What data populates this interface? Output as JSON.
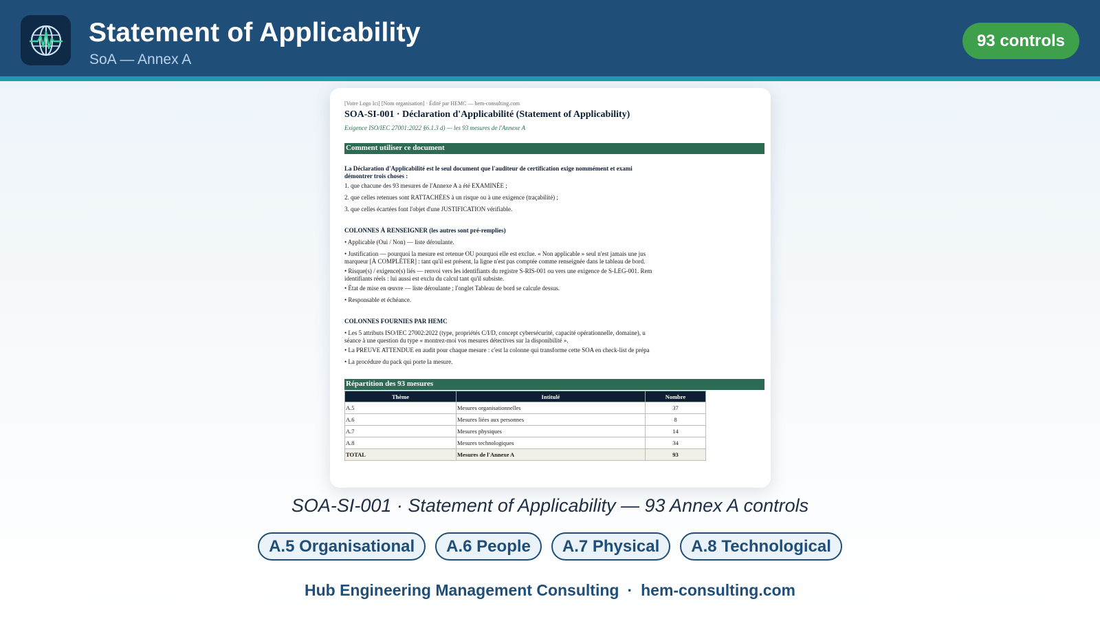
{
  "colors": {
    "header_bg": "#1f4e79",
    "header_accent": "#1f9bb0",
    "badge_green": "#3ea04a",
    "section_green": "#2e6b55",
    "table_header": "#0e1f33"
  },
  "header": {
    "logo_icon": "globe-heartbeat-icon",
    "title": "Statement of Applicability",
    "subtitle": "SoA — Annex A",
    "badge": "93 controls"
  },
  "document": {
    "meta": "[Votre Logo Ici]  [Nom organisation]  · Édité par HEMC — hem-consulting.com",
    "title": "SOA-SI-001 · Déclaration d'Applicabilité (Statement of Applicability)",
    "requirement": "Exigence ISO/IEC 27001:2022 §6.1.3 d) — les 93 mesures de l'Annexe A",
    "section1": "Comment utiliser ce document",
    "intro_line1": "La Déclaration d'Applicabilité est le seul document que l'auditeur de certification exige nommément et exami",
    "intro_line2": "démontrer trois choses :",
    "point1": "1. que chacune des 93 mesures de l'Annexe A a été EXAMINÉE ;",
    "point2": "2. que celles retenues sont RATTACHÉES à un risque ou à une exigence (traçabilité) ;",
    "point3": "3. que celles écartées font l'objet d'une JUSTIFICATION vérifiable.",
    "cols_title": "COLONNES À RENSEIGNER (les autres sont pré-remplies)",
    "col1": "• Applicable (Oui / Non) — liste déroulante.",
    "col2a": "• Justification — pourquoi la mesure est retenue OU pourquoi elle est exclue. « Non applicable » seul n'est jamais une jus",
    "col2b": "marqueur [À COMPLÉTER] : tant qu'il est présent, la ligne n'est pas comptée comme renseignée dans le tableau de bord.",
    "col3a": "• Risque(s) / exigence(s) liés — renvoi vers les identifiants du registre S-RIS-001 ou vers une exigence de S-LEG-001. Rem",
    "col3b": "identifiants réels : lui aussi est exclu du calcul tant qu'il subsiste.",
    "col4": "• État de mise en œuvre — liste déroulante ; l'onglet Tableau de bord se calcule dessus.",
    "col5": "• Responsable et échéance.",
    "hemc_title": "COLONNES FOURNIES PAR HEMC",
    "hemc1a": "• Les 5 attributs ISO/IEC 27002:2022 (type, propriétés C/I/D, concept cybersécurité, capacité opérationnelle, domaine), u",
    "hemc1b": "séance à une question du type « montrez-moi vos mesures détectives sur la disponibilité ».",
    "hemc2": "• La PREUVE ATTENDUE en audit pour chaque mesure : c'est la colonne qui transforme cette SOA en check-list de prépa",
    "hemc3": "• La procédure du pack qui porte la mesure.",
    "section2": "Répartition des 93 mesures",
    "table": {
      "headers": [
        "Thème",
        "Intitulé",
        "Nombre"
      ],
      "rows": [
        [
          "A.5",
          "Mesures organisationnelles",
          "37"
        ],
        [
          "A.6",
          "Mesures liées aux personnes",
          "8"
        ],
        [
          "A.7",
          "Mesures physiques",
          "14"
        ],
        [
          "A.8",
          "Mesures technologiques",
          "34"
        ]
      ],
      "total": [
        "TOTAL",
        "Mesures de l'Annexe A",
        "93"
      ]
    }
  },
  "caption": "SOA-SI-001 · Statement of Applicability — 93 Annex A controls",
  "tags": [
    "A.5 Organisational",
    "A.6 People",
    "A.7 Physical",
    "A.8 Technological"
  ],
  "footer": {
    "company": "Hub Engineering Management Consulting",
    "separator": "·",
    "website": "hem-consulting.com"
  }
}
